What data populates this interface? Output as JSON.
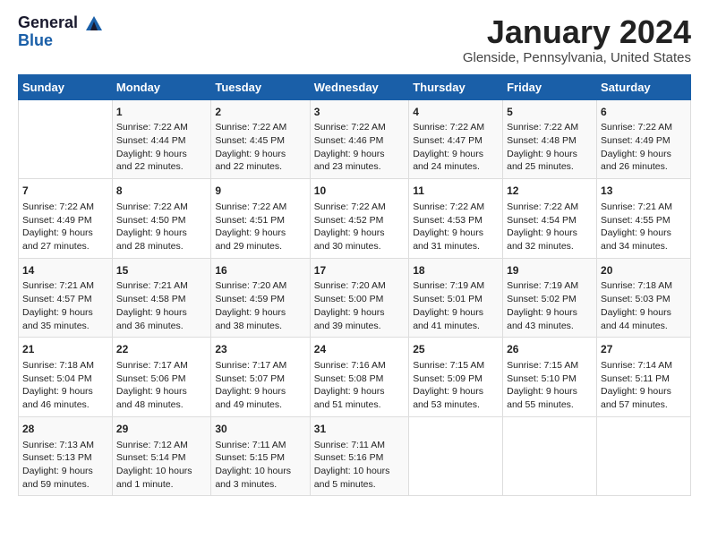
{
  "logo": {
    "line1": "General",
    "line2": "Blue"
  },
  "title": "January 2024",
  "location": "Glenside, Pennsylvania, United States",
  "days_of_week": [
    "Sunday",
    "Monday",
    "Tuesday",
    "Wednesday",
    "Thursday",
    "Friday",
    "Saturday"
  ],
  "weeks": [
    [
      {
        "day": "",
        "content": ""
      },
      {
        "day": "1",
        "content": "Sunrise: 7:22 AM\nSunset: 4:44 PM\nDaylight: 9 hours\nand 22 minutes."
      },
      {
        "day": "2",
        "content": "Sunrise: 7:22 AM\nSunset: 4:45 PM\nDaylight: 9 hours\nand 22 minutes."
      },
      {
        "day": "3",
        "content": "Sunrise: 7:22 AM\nSunset: 4:46 PM\nDaylight: 9 hours\nand 23 minutes."
      },
      {
        "day": "4",
        "content": "Sunrise: 7:22 AM\nSunset: 4:47 PM\nDaylight: 9 hours\nand 24 minutes."
      },
      {
        "day": "5",
        "content": "Sunrise: 7:22 AM\nSunset: 4:48 PM\nDaylight: 9 hours\nand 25 minutes."
      },
      {
        "day": "6",
        "content": "Sunrise: 7:22 AM\nSunset: 4:49 PM\nDaylight: 9 hours\nand 26 minutes."
      }
    ],
    [
      {
        "day": "7",
        "content": "Sunrise: 7:22 AM\nSunset: 4:49 PM\nDaylight: 9 hours\nand 27 minutes."
      },
      {
        "day": "8",
        "content": "Sunrise: 7:22 AM\nSunset: 4:50 PM\nDaylight: 9 hours\nand 28 minutes."
      },
      {
        "day": "9",
        "content": "Sunrise: 7:22 AM\nSunset: 4:51 PM\nDaylight: 9 hours\nand 29 minutes."
      },
      {
        "day": "10",
        "content": "Sunrise: 7:22 AM\nSunset: 4:52 PM\nDaylight: 9 hours\nand 30 minutes."
      },
      {
        "day": "11",
        "content": "Sunrise: 7:22 AM\nSunset: 4:53 PM\nDaylight: 9 hours\nand 31 minutes."
      },
      {
        "day": "12",
        "content": "Sunrise: 7:22 AM\nSunset: 4:54 PM\nDaylight: 9 hours\nand 32 minutes."
      },
      {
        "day": "13",
        "content": "Sunrise: 7:21 AM\nSunset: 4:55 PM\nDaylight: 9 hours\nand 34 minutes."
      }
    ],
    [
      {
        "day": "14",
        "content": "Sunrise: 7:21 AM\nSunset: 4:57 PM\nDaylight: 9 hours\nand 35 minutes."
      },
      {
        "day": "15",
        "content": "Sunrise: 7:21 AM\nSunset: 4:58 PM\nDaylight: 9 hours\nand 36 minutes."
      },
      {
        "day": "16",
        "content": "Sunrise: 7:20 AM\nSunset: 4:59 PM\nDaylight: 9 hours\nand 38 minutes."
      },
      {
        "day": "17",
        "content": "Sunrise: 7:20 AM\nSunset: 5:00 PM\nDaylight: 9 hours\nand 39 minutes."
      },
      {
        "day": "18",
        "content": "Sunrise: 7:19 AM\nSunset: 5:01 PM\nDaylight: 9 hours\nand 41 minutes."
      },
      {
        "day": "19",
        "content": "Sunrise: 7:19 AM\nSunset: 5:02 PM\nDaylight: 9 hours\nand 43 minutes."
      },
      {
        "day": "20",
        "content": "Sunrise: 7:18 AM\nSunset: 5:03 PM\nDaylight: 9 hours\nand 44 minutes."
      }
    ],
    [
      {
        "day": "21",
        "content": "Sunrise: 7:18 AM\nSunset: 5:04 PM\nDaylight: 9 hours\nand 46 minutes."
      },
      {
        "day": "22",
        "content": "Sunrise: 7:17 AM\nSunset: 5:06 PM\nDaylight: 9 hours\nand 48 minutes."
      },
      {
        "day": "23",
        "content": "Sunrise: 7:17 AM\nSunset: 5:07 PM\nDaylight: 9 hours\nand 49 minutes."
      },
      {
        "day": "24",
        "content": "Sunrise: 7:16 AM\nSunset: 5:08 PM\nDaylight: 9 hours\nand 51 minutes."
      },
      {
        "day": "25",
        "content": "Sunrise: 7:15 AM\nSunset: 5:09 PM\nDaylight: 9 hours\nand 53 minutes."
      },
      {
        "day": "26",
        "content": "Sunrise: 7:15 AM\nSunset: 5:10 PM\nDaylight: 9 hours\nand 55 minutes."
      },
      {
        "day": "27",
        "content": "Sunrise: 7:14 AM\nSunset: 5:11 PM\nDaylight: 9 hours\nand 57 minutes."
      }
    ],
    [
      {
        "day": "28",
        "content": "Sunrise: 7:13 AM\nSunset: 5:13 PM\nDaylight: 9 hours\nand 59 minutes."
      },
      {
        "day": "29",
        "content": "Sunrise: 7:12 AM\nSunset: 5:14 PM\nDaylight: 10 hours\nand 1 minute."
      },
      {
        "day": "30",
        "content": "Sunrise: 7:11 AM\nSunset: 5:15 PM\nDaylight: 10 hours\nand 3 minutes."
      },
      {
        "day": "31",
        "content": "Sunrise: 7:11 AM\nSunset: 5:16 PM\nDaylight: 10 hours\nand 5 minutes."
      },
      {
        "day": "",
        "content": ""
      },
      {
        "day": "",
        "content": ""
      },
      {
        "day": "",
        "content": ""
      }
    ]
  ]
}
